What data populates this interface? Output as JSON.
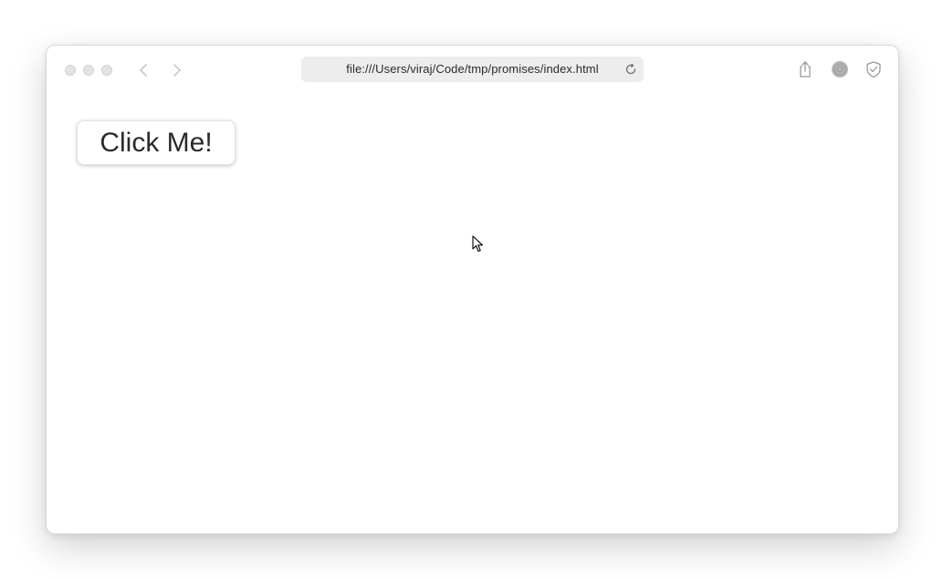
{
  "browser": {
    "address": "file:///Users/viraj/Code/tmp/promises/index.html",
    "icons": {
      "back": "chevron-left-icon",
      "forward": "chevron-right-icon",
      "reload": "reload-icon",
      "share": "share-icon",
      "extension": "extension-icon",
      "shield": "shield-icon"
    }
  },
  "page": {
    "button_label": "Click Me!"
  }
}
